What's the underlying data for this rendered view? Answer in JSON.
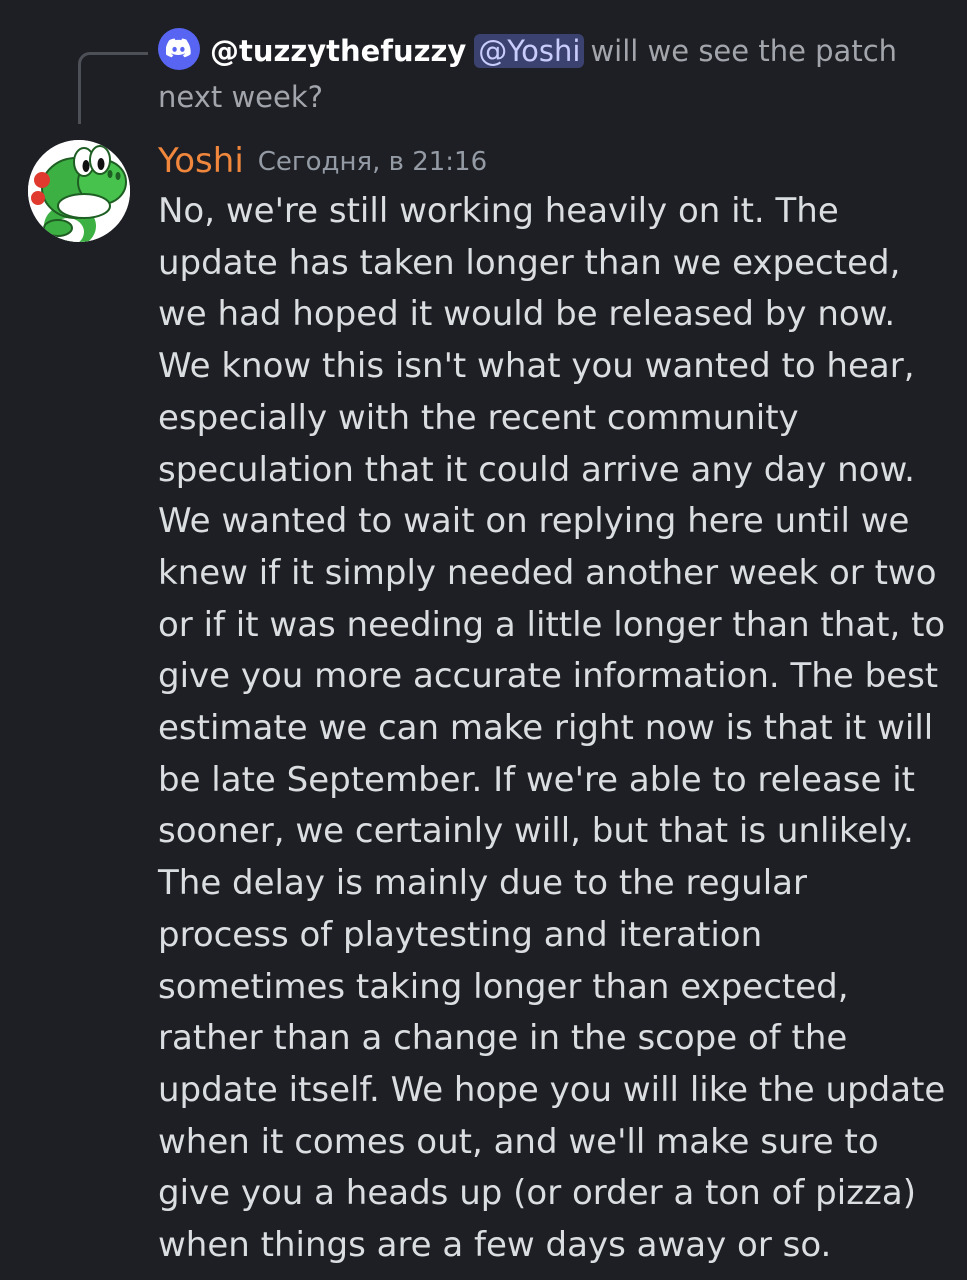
{
  "reply": {
    "icon": "discord-icon",
    "author": "@tuzzythefuzzy",
    "mention": "@Yoshi",
    "text": "will we see the patch next week?"
  },
  "message": {
    "avatar": "yoshi-avatar",
    "username": "Yoshi",
    "timestamp": "Сегодня, в 21:16",
    "text": "No, we're still working heavily on it. The update has taken longer than we expected, we had hoped it would be released by now. We know this isn't what you wanted to hear, especially with the recent community speculation that it could arrive any day now. We wanted to wait on replying here until we knew if it simply needed another week or two or if it was needing a little longer than that, to give you more accurate information. The best estimate we can make right now is that it will be late September. If we're able to release it sooner, we certainly will, but that is unlikely. The delay is mainly due to the regular process of playtesting and iteration sometimes taking longer than expected, rather than a change in the scope of the update itself. We hope you will like the update when it comes out, and we'll make sure to give you a heads up (or order a ton of pizza) when things are a few days away or so."
  },
  "colors": {
    "background": "#1e1f24",
    "username": "#f0873c",
    "mention_bg": "#3c4270",
    "discord_blurple": "#5865f2"
  }
}
